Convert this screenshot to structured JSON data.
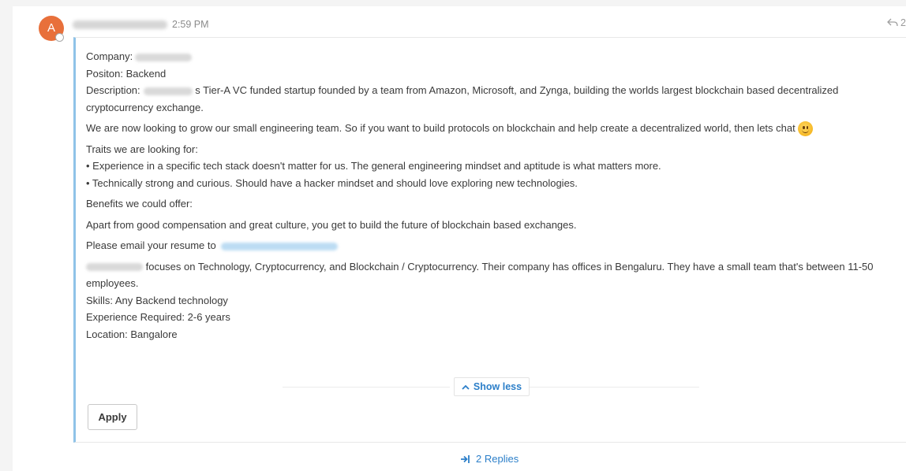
{
  "message": {
    "avatar_initial": "A",
    "time": "2:59 PM",
    "reply_count_header": "2",
    "lines": {
      "company_label": "Company:",
      "position": "Positon: Backend",
      "description_label": "Description:",
      "description_text": " s Tier-A VC funded startup founded by a team from Amazon, Microsoft, and Zynga, building the worlds largest blockchain based decentralized cryptocurrency exchange.",
      "grow_text": "We are now looking to grow our small engineering team. So if you want to build protocols on blockchain and help create a decentralized world, then lets chat ",
      "traits_heading": "Traits we are looking for:",
      "trait_1": "• Experience in a specific tech stack doesn't matter for us. The general engineering mindset and aptitude is what matters more.",
      "trait_2": "• Technically strong and curious. Should have a hacker mindset and should love exploring new technologies.",
      "benefits_heading": "Benefits we could offer:",
      "benefits_text": "Apart from good compensation and great culture, you get to build the future of blockchain based exchanges.",
      "email_text": "Please email your resume to ",
      "focus_text": " focuses on Technology, Cryptocurrency, and Blockchain / Cryptocurrency. Their company has offices in Bengaluru. They have a small team that's between 11-50 employees.",
      "skills": "Skills: Any Backend technology",
      "experience": "Experience Required: 2-6 years",
      "location": "Location: Bangalore"
    },
    "show_less_label": "Show less",
    "apply_label": "Apply",
    "replies_label": "2 Replies"
  },
  "colors": {
    "avatar": "#e8703b",
    "accent_border": "#8fc3e8",
    "link": "#2c7fc9"
  },
  "icons": [
    "reply-icon",
    "chevron-up-icon",
    "smiley-emoji-icon",
    "reply-arrow-icon"
  ]
}
